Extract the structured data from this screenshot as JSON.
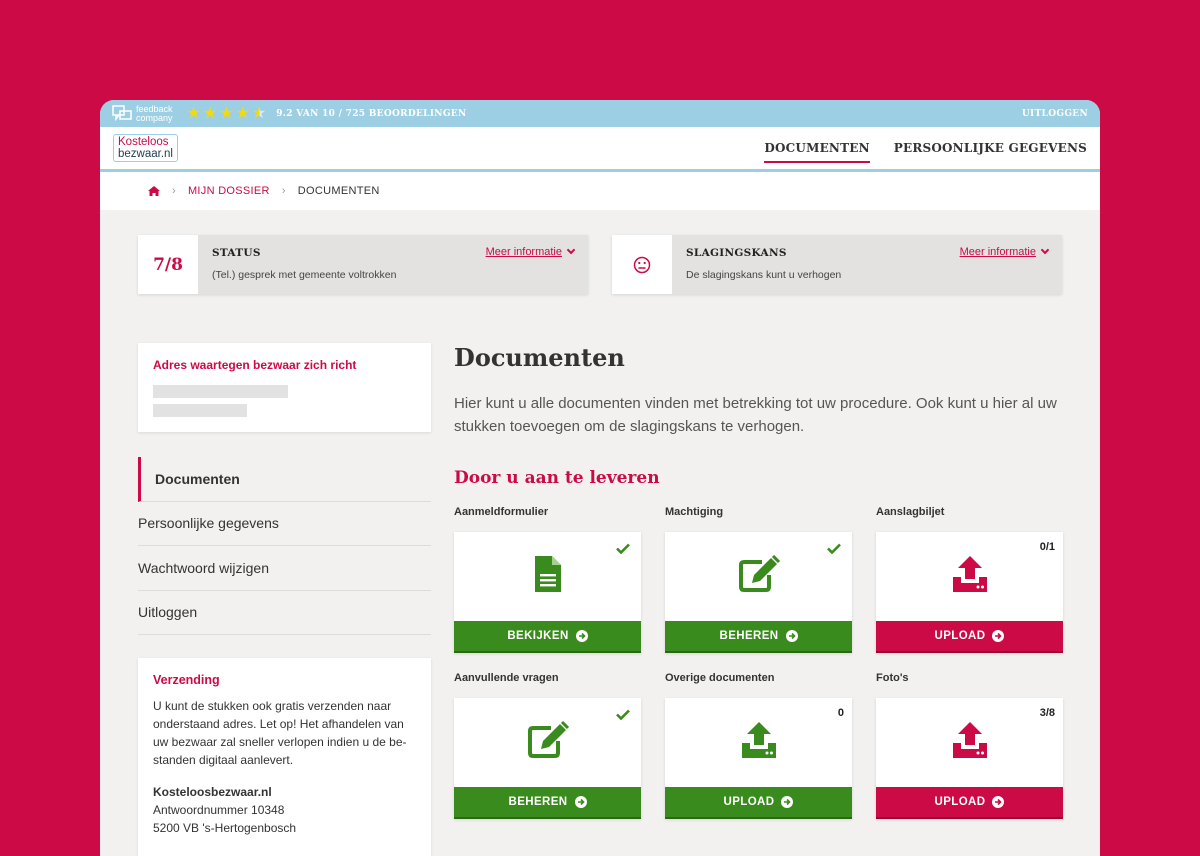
{
  "colors": {
    "brand": "#cc0a45",
    "green": "#3a8b1d",
    "topbar": "#9dcfe4"
  },
  "topbar": {
    "feedback_line1": "feedback",
    "feedback_line2": "company",
    "rating_text": "9.2 VAN 10 / 725 BEOORDELINGEN",
    "stars": 4.5,
    "logout": "UITLOGGEN"
  },
  "header": {
    "logo_line1": "Kosteloos",
    "logo_line2": "bezwaar.nl",
    "nav": [
      {
        "label": "DOCUMENTEN",
        "active": true
      },
      {
        "label": "PERSOONLIJKE GEGEVENS",
        "active": false
      }
    ]
  },
  "breadcrumb": {
    "home_icon": "home-icon",
    "items": [
      "MIJN DOSSIER",
      "DOCUMENTEN"
    ]
  },
  "status": {
    "step": "7/8",
    "title": "STATUS",
    "subtitle": "(Tel.) gesprek met gemeente voltrokken",
    "more": "Meer informatie"
  },
  "chance": {
    "icon": "neutral-face-icon",
    "title": "SLAGINGSKANS",
    "subtitle": "De slagingskans kunt u verhogen",
    "more": "Meer informatie"
  },
  "address_card": {
    "title": "Adres waartegen bezwaar zich richt"
  },
  "side_nav": [
    "Documenten",
    "Persoonlijke gegevens",
    "Wachtwoord wijzigen",
    "Uitloggen"
  ],
  "shipping": {
    "title": "Verzending",
    "body": "U kunt de stukken ook gratis verzenden naar onderstaand adres. Let op! Het afhandelen van uw bezwaar zal sneller verlopen indien u de be-standen digitaal aanlevert.",
    "name": "Kosteloosbezwaar.nl",
    "line1": "Antwoordnummer 10348",
    "line2": "5200 VB 's-Hertogenbosch"
  },
  "main": {
    "title": "Documenten",
    "intro": "Hier kunt u alle documenten vinden met betrekking tot uw procedure. Ook kunt u hier al uw stukken toevoegen om de slagingskans te verhogen.",
    "section": "Door u aan te leveren"
  },
  "documents": [
    {
      "label": "Aanmeldformulier",
      "icon": "document-icon",
      "button": "BEKIJKEN",
      "color": "green",
      "done": true,
      "count": ""
    },
    {
      "label": "Machtiging",
      "icon": "edit-icon",
      "button": "BEHEREN",
      "color": "green",
      "done": true,
      "count": ""
    },
    {
      "label": "Aanslagbiljet",
      "icon": "upload-icon",
      "button": "UPLOAD",
      "color": "red",
      "done": false,
      "count": "0/1"
    },
    {
      "label": "Aanvullende vragen",
      "icon": "edit-icon",
      "button": "BEHEREN",
      "color": "green",
      "done": true,
      "count": ""
    },
    {
      "label": "Overige documenten",
      "icon": "upload-icon",
      "button": "UPLOAD",
      "color": "green",
      "done": false,
      "count": "0"
    },
    {
      "label": "Foto's",
      "icon": "upload-icon",
      "button": "UPLOAD",
      "color": "red",
      "done": false,
      "count": "3/8"
    }
  ]
}
